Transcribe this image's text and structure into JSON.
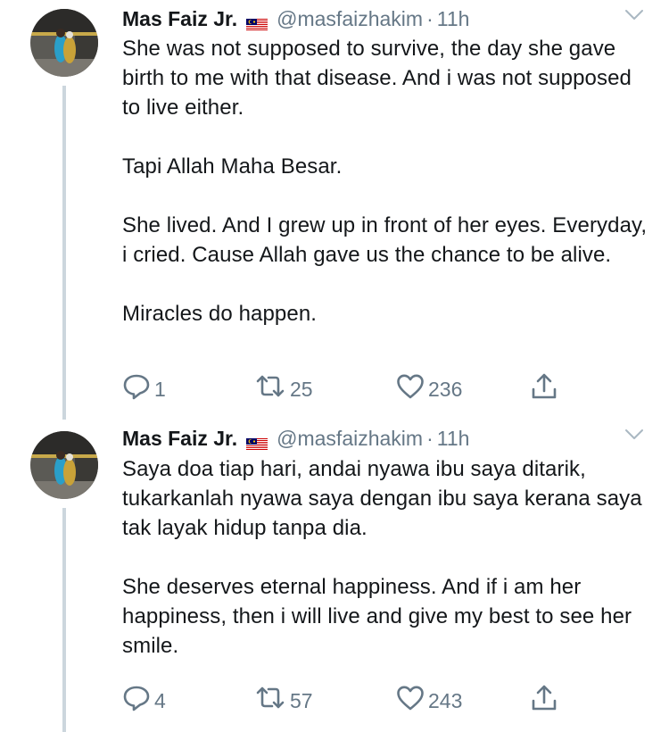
{
  "tweets": [
    {
      "name": "Mas Faiz Jr.",
      "handle": "@masfaizhakim",
      "separator": "·",
      "time": "11h",
      "paragraphs": [
        "She was not supposed to survive, the day she gave birth to me with that disease. And i was not supposed to live either.",
        "Tapi Allah Maha Besar.",
        "She lived. And I grew up in front of her eyes. Everyday, i cried. Cause Allah gave us the chance to be alive.",
        "Miracles do happen."
      ],
      "replies": "1",
      "retweets": "25",
      "likes": "236"
    },
    {
      "name": "Mas Faiz Jr.",
      "handle": "@masfaizhakim",
      "separator": "·",
      "time": "11h",
      "paragraphs": [
        "Saya doa tiap hari, andai nyawa ibu saya ditarik, tukarkanlah nyawa saya dengan ibu saya kerana saya tak layak hidup tanpa dia.",
        "She deserves eternal happiness. And if i am her happiness, then i will live and give my best to see her smile."
      ],
      "replies": "4",
      "retweets": "57",
      "likes": "243"
    }
  ],
  "icons": {
    "flag": "malaysia-flag-icon",
    "chevron": "chevron-down-icon",
    "reply": "reply-icon",
    "retweet": "retweet-icon",
    "like": "heart-icon",
    "share": "share-icon"
  },
  "colors": {
    "text": "#14171a",
    "muted": "#657786",
    "thread_line": "#ccd6dd"
  }
}
